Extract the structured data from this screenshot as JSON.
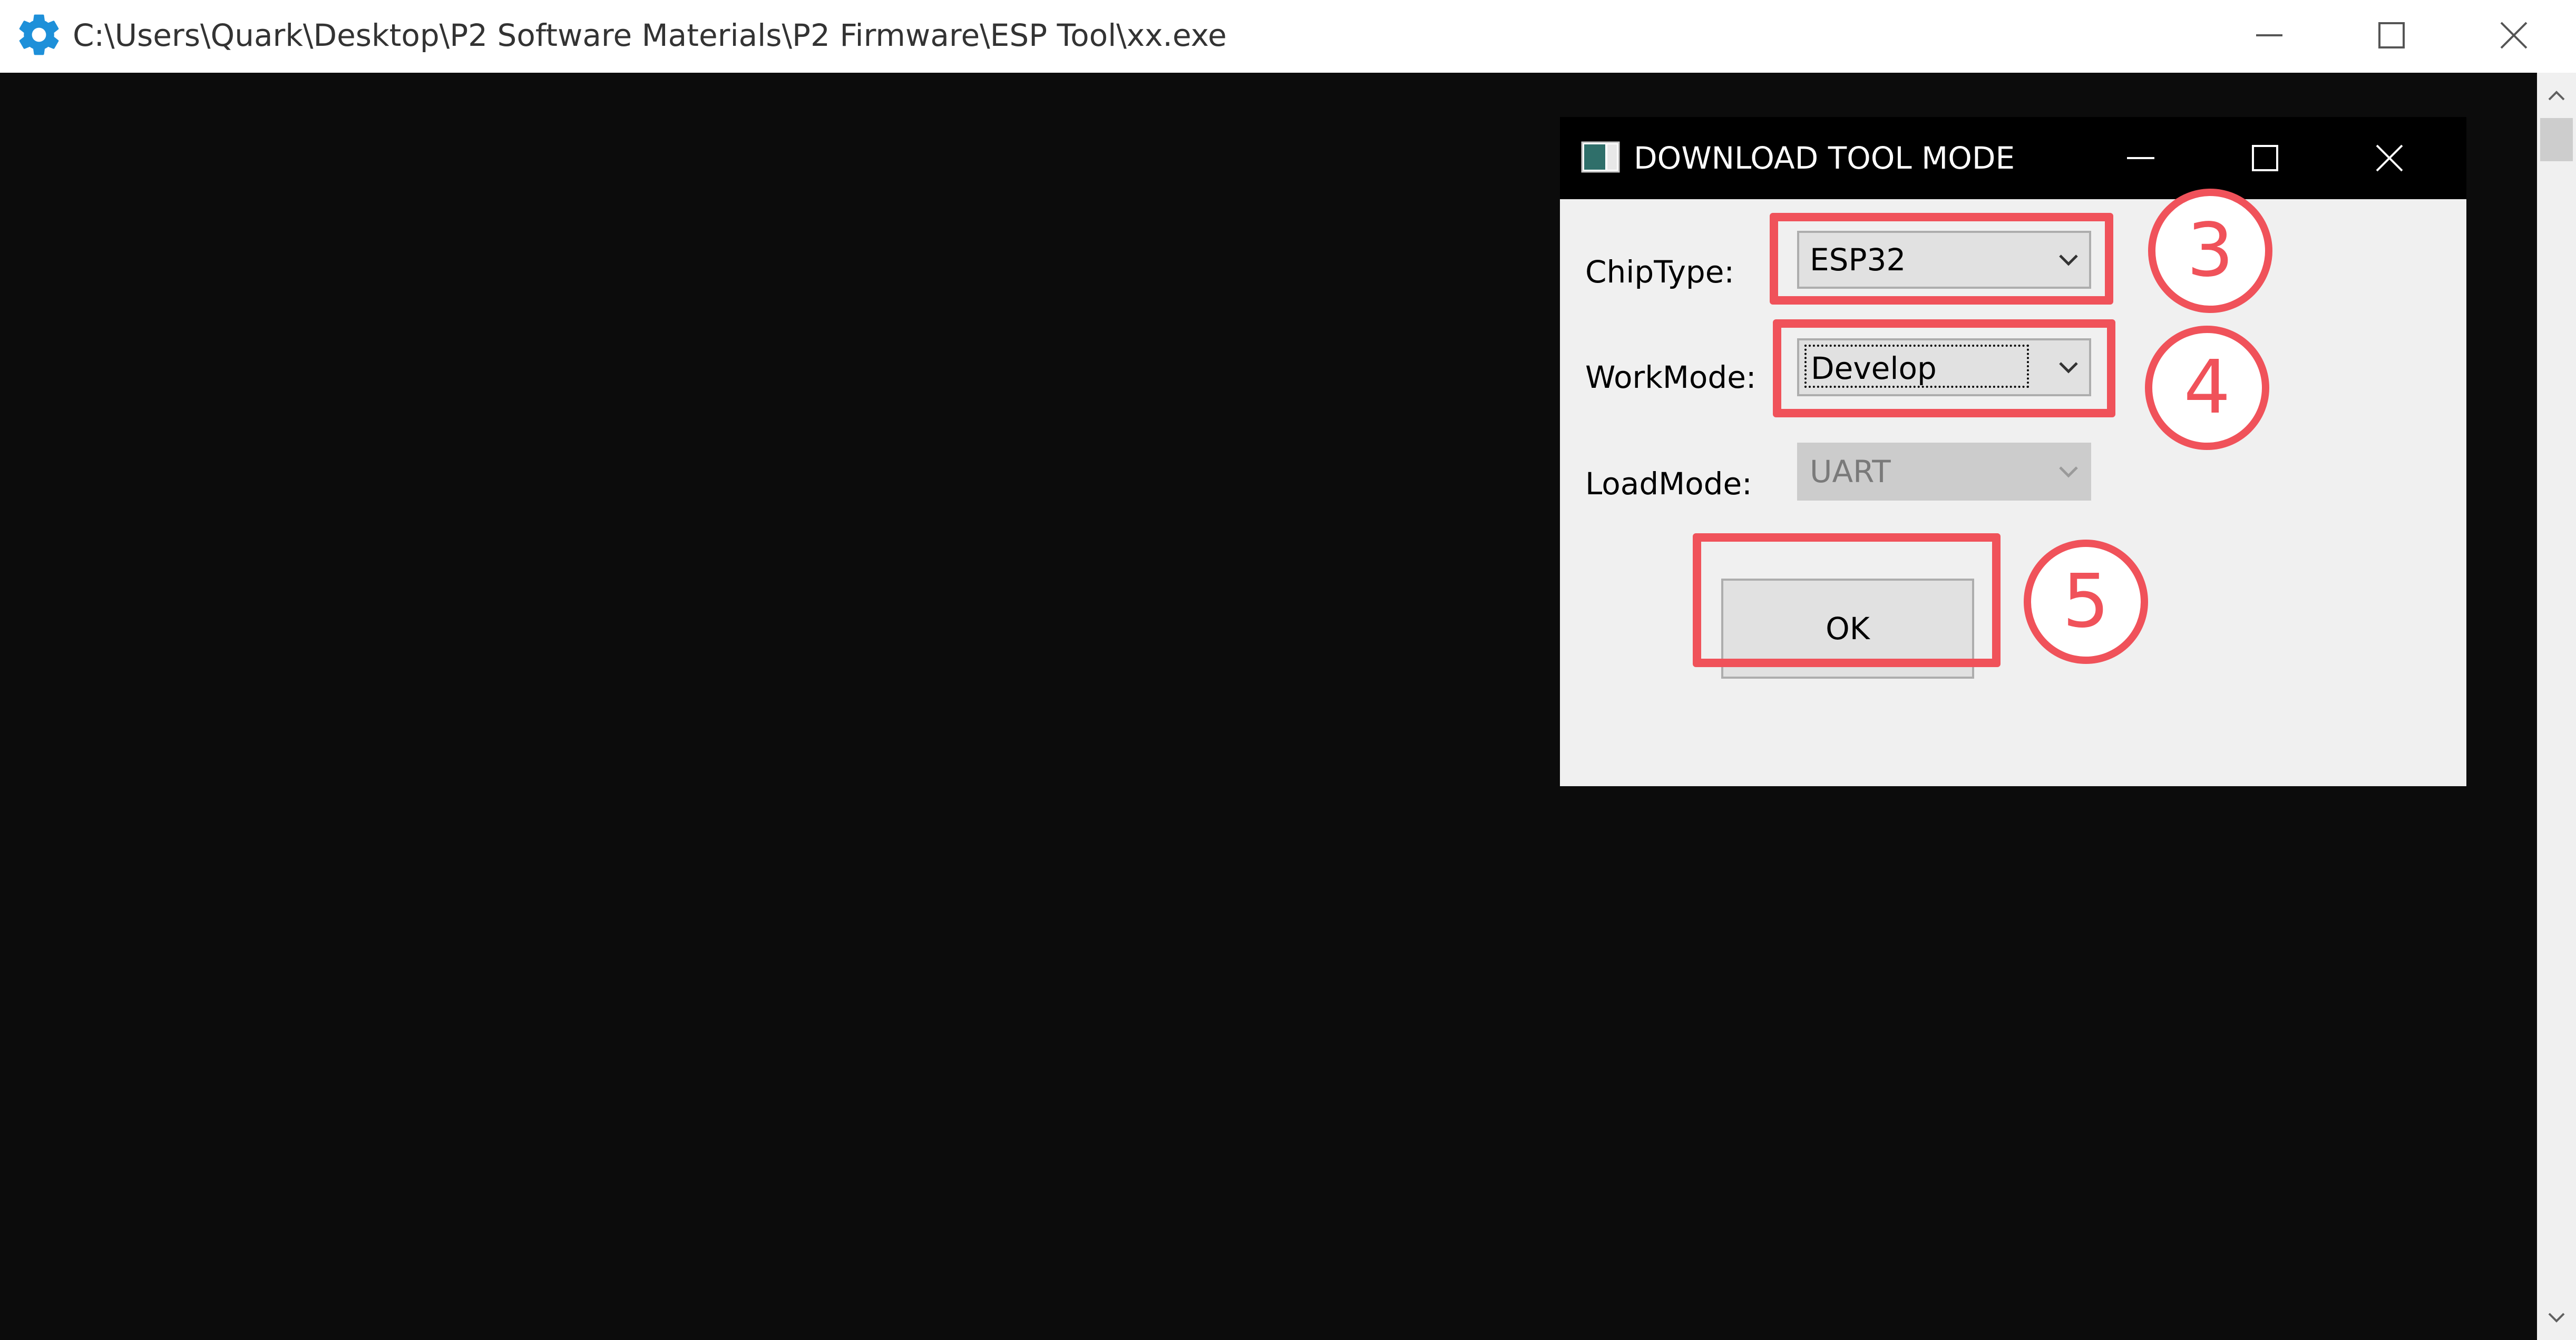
{
  "console": {
    "title": "C:\\Users\\Quark\\Desktop\\P2 Software Materials\\P2 Firmware\\ESP Tool\\xx.exe",
    "icon": "gear-icon",
    "icon_color": "#1e90d9",
    "controls": [
      "minimize",
      "maximize",
      "close"
    ]
  },
  "dialog": {
    "title": "DOWNLOAD TOOL MODE",
    "fields": [
      {
        "label": "ChipType:",
        "value": "ESP32",
        "enabled": true
      },
      {
        "label": "WorkMode:",
        "value": "Develop",
        "enabled": true,
        "focused": true
      },
      {
        "label": "LoadMode:",
        "value": "UART",
        "enabled": false
      }
    ],
    "ok_label": "OK"
  },
  "annotations": {
    "color": "#f0525a",
    "steps": [
      "3",
      "4",
      "5"
    ]
  }
}
